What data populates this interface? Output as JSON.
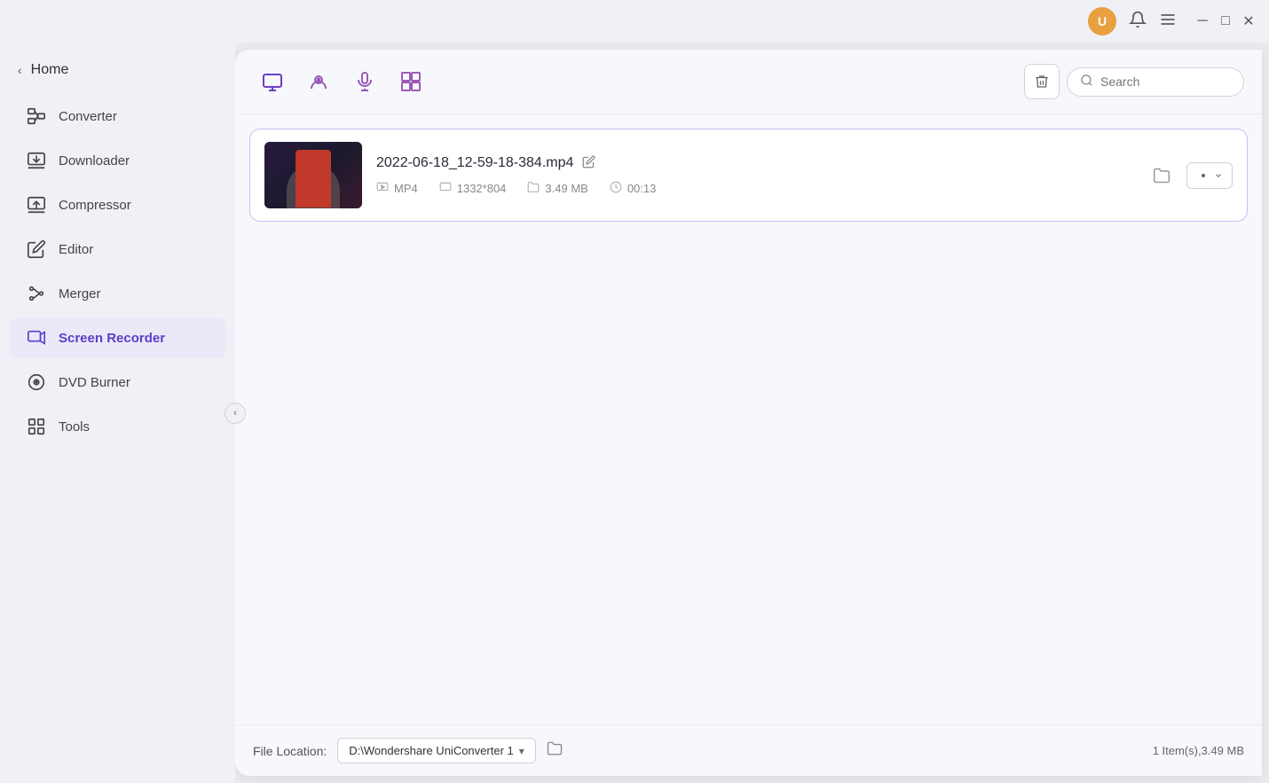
{
  "titleBar": {
    "avatar": "U",
    "avatarColor": "#e8a040",
    "controls": [
      "minimize",
      "maximize",
      "close"
    ]
  },
  "sidebar": {
    "homeLabel": "Home",
    "items": [
      {
        "id": "converter",
        "label": "Converter",
        "icon": "converter"
      },
      {
        "id": "downloader",
        "label": "Downloader",
        "icon": "downloader"
      },
      {
        "id": "compressor",
        "label": "Compressor",
        "icon": "compressor"
      },
      {
        "id": "editor",
        "label": "Editor",
        "icon": "editor"
      },
      {
        "id": "merger",
        "label": "Merger",
        "icon": "merger"
      },
      {
        "id": "screen-recorder",
        "label": "Screen Recorder",
        "icon": "screen-recorder",
        "active": true
      },
      {
        "id": "dvd-burner",
        "label": "DVD Burner",
        "icon": "dvd-burner"
      },
      {
        "id": "tools",
        "label": "Tools",
        "icon": "tools"
      }
    ]
  },
  "toolbar": {
    "tools": [
      {
        "id": "screen-record",
        "icon": "screen",
        "active": true
      },
      {
        "id": "webcam",
        "icon": "webcam",
        "active": false
      },
      {
        "id": "audio",
        "icon": "audio",
        "active": false
      },
      {
        "id": "snapshots",
        "icon": "snapshots",
        "active": false
      }
    ],
    "trashLabel": "🗑",
    "searchPlaceholder": "Search"
  },
  "files": [
    {
      "id": 1,
      "name": "2022-06-18_12-59-18-384.mp4",
      "format": "MP4",
      "resolution": "1332*804",
      "size": "3.49 MB",
      "duration": "00:13"
    }
  ],
  "footer": {
    "fileLocationLabel": "File Location:",
    "locationPath": "D:\\Wondershare UniConverter 1",
    "itemCount": "1 Item(s),3.49 MB"
  }
}
